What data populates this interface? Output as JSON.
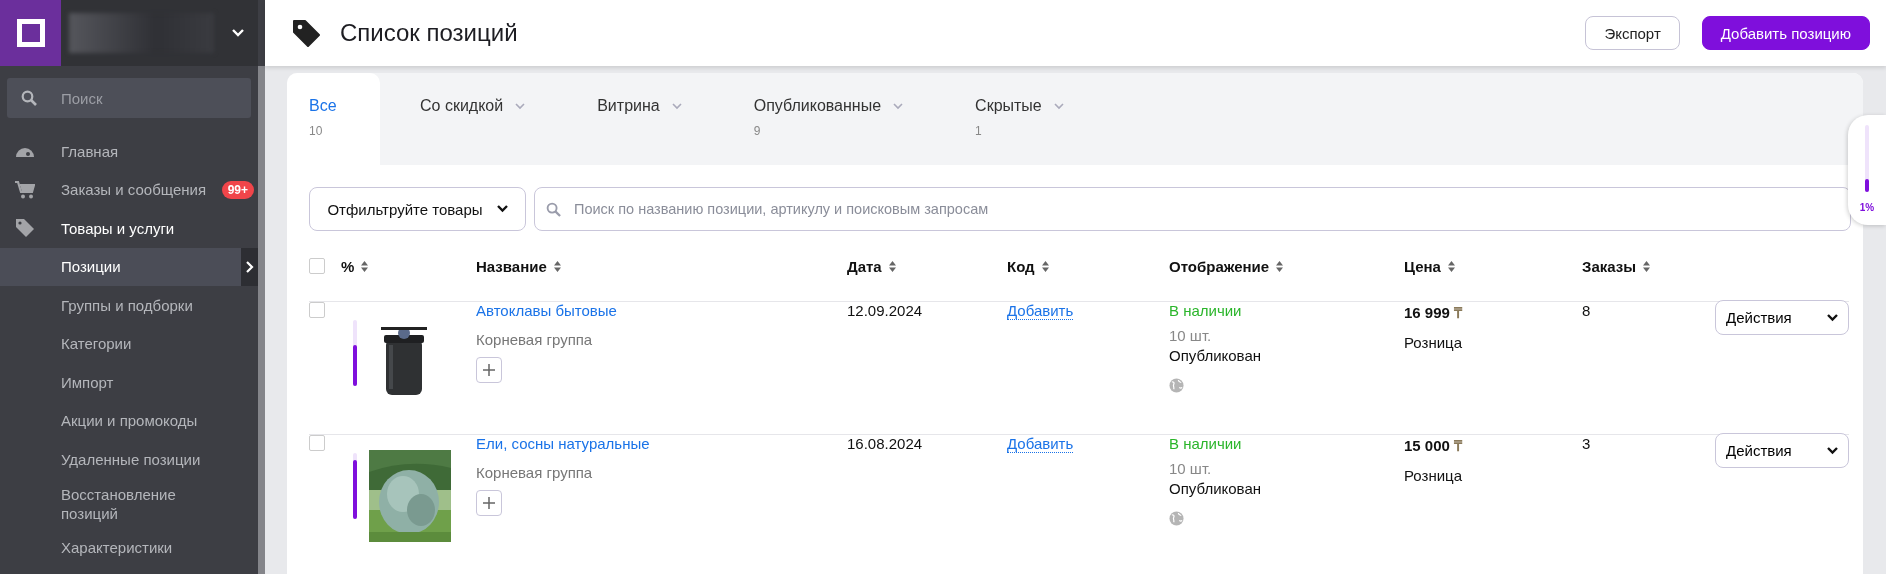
{
  "sidebar": {
    "search": {
      "placeholder": "Поиск"
    },
    "items": [
      {
        "label": "Главная",
        "expanded": false
      },
      {
        "label": "Заказы и сообщения",
        "badge": "99+",
        "expanded": false
      },
      {
        "label": "Товары и услуги",
        "expanded": true,
        "children": [
          {
            "label": "Позиции",
            "selected": true
          },
          {
            "label": "Группы и подборки",
            "selected": false
          },
          {
            "label": "Категории",
            "selected": false
          },
          {
            "label": "Импорт",
            "selected": false
          },
          {
            "label": "Акции и промокоды",
            "selected": false
          },
          {
            "label": "Удаленные позиции",
            "selected": false
          },
          {
            "label": "Восстановление позиций",
            "selected": false
          },
          {
            "label": "Характеристики",
            "selected": false
          }
        ]
      }
    ]
  },
  "header": {
    "title": "Список позиций",
    "buttons": [
      {
        "label": "Экспорт",
        "kind": "secondary"
      },
      {
        "label": "Добавить позицию",
        "kind": "primary"
      }
    ]
  },
  "tabs": [
    {
      "label": "Все",
      "count": "10",
      "selected": true,
      "dropdown": false
    },
    {
      "label": "Со скидкой",
      "selected": false,
      "dropdown": true
    },
    {
      "label": "Витрина",
      "selected": false,
      "dropdown": true
    },
    {
      "label": "Опубликованные",
      "count": "9",
      "selected": false,
      "dropdown": true
    },
    {
      "label": "Скрытые",
      "count": "1",
      "selected": false,
      "dropdown": true
    }
  ],
  "filter": {
    "button": "Отфильтруйте товары",
    "search_placeholder": "Поиск по названию позиции, артикулу и поисковым запросам"
  },
  "progress_widget": {
    "level": 0.2,
    "reading": "1%"
  },
  "table": {
    "select_all_checked": false,
    "columns": [
      "%",
      "Название",
      "Дата",
      "Код",
      "Отображение",
      "Цена",
      "Заказы"
    ],
    "rows": [
      {
        "checked": false,
        "level": 0.62,
        "name": "Автоклавы бытовые",
        "group": "Корневая группа",
        "date": "12.09.2024",
        "code_link": "Добавить",
        "availability": "В наличии",
        "quantity": "10 шт.",
        "status": "Опубликован",
        "price": "16 999",
        "currency": "₸",
        "price_type": "Розница",
        "orders": "8",
        "action": "Действия"
      },
      {
        "checked": false,
        "level": 0.9,
        "name": "Ели, сосны натуральные",
        "group": "Корневая группа",
        "date": "16.08.2024",
        "code_link": "Добавить",
        "availability": "В наличии",
        "quantity": "10 шт.",
        "status": "Опубликован",
        "price": "15 000",
        "currency": "₸",
        "price_type": "Розница",
        "orders": "3",
        "action": "Действия"
      }
    ]
  }
}
